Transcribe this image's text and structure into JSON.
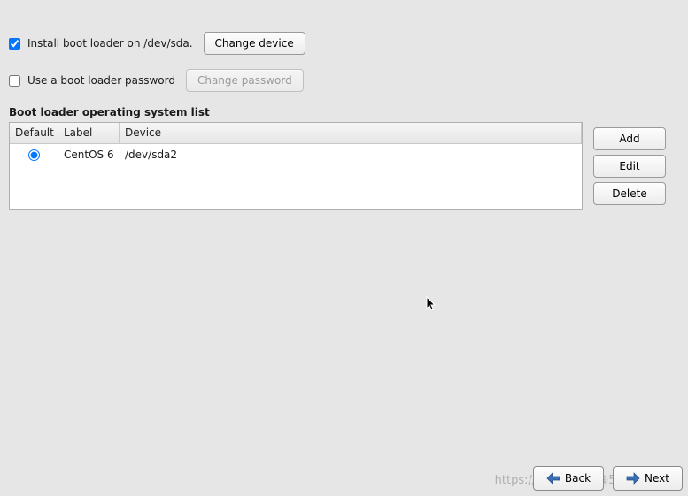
{
  "options": {
    "install_bootloader": {
      "checked": true,
      "label": "Install boot loader on /dev/sda.",
      "change_button": "Change device"
    },
    "use_password": {
      "checked": false,
      "label": "Use a boot loader password",
      "change_button": "Change password"
    }
  },
  "oslist": {
    "title": "Boot loader operating system list",
    "headers": {
      "default": "Default",
      "label": "Label",
      "device": "Device"
    },
    "rows": [
      {
        "default": true,
        "label": "CentOS 6",
        "device": "/dev/sda2"
      }
    ],
    "side_buttons": {
      "add": "Add",
      "edit": "Edit",
      "delete": "Delete"
    }
  },
  "footer": {
    "back": "Back",
    "next": "Next"
  },
  "watermark": "https://blog.51cto@51CTO博客"
}
